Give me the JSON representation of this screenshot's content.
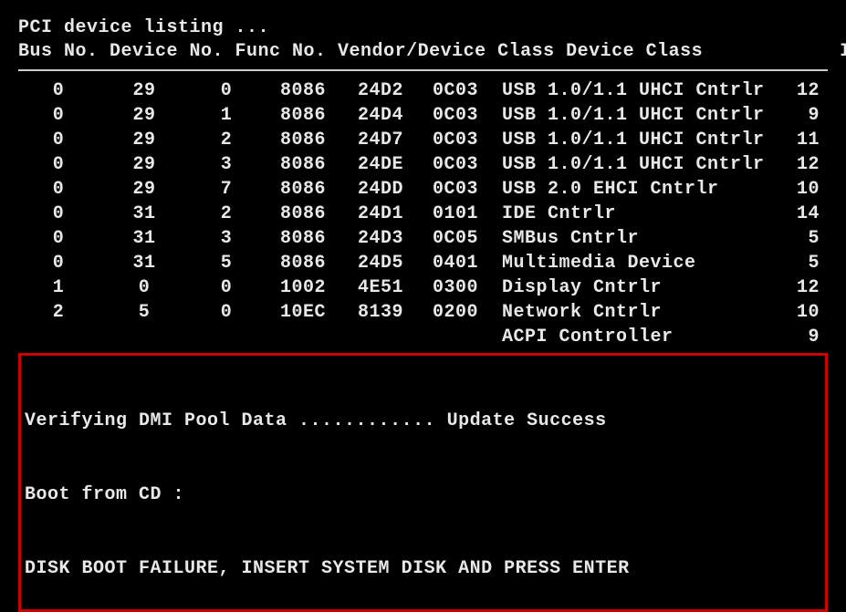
{
  "header": {
    "title": "PCI device listing ...",
    "columns": "Bus No. Device No. Func No. Vendor/Device Class Device Class            IRQ"
  },
  "rows": [
    {
      "bus": "0",
      "dev": "29",
      "func": "0",
      "vendor": "8086",
      "cls1": "24D2",
      "cls2": "0C03",
      "name": "USB 1.0/1.1 UHCI Cntrlr",
      "irq": "12"
    },
    {
      "bus": "0",
      "dev": "29",
      "func": "1",
      "vendor": "8086",
      "cls1": "24D4",
      "cls2": "0C03",
      "name": "USB 1.0/1.1 UHCI Cntrlr",
      "irq": "9"
    },
    {
      "bus": "0",
      "dev": "29",
      "func": "2",
      "vendor": "8086",
      "cls1": "24D7",
      "cls2": "0C03",
      "name": "USB 1.0/1.1 UHCI Cntrlr",
      "irq": "11"
    },
    {
      "bus": "0",
      "dev": "29",
      "func": "3",
      "vendor": "8086",
      "cls1": "24DE",
      "cls2": "0C03",
      "name": "USB 1.0/1.1 UHCI Cntrlr",
      "irq": "12"
    },
    {
      "bus": "0",
      "dev": "29",
      "func": "7",
      "vendor": "8086",
      "cls1": "24DD",
      "cls2": "0C03",
      "name": "USB 2.0 EHCI Cntrlr",
      "irq": "10"
    },
    {
      "bus": "0",
      "dev": "31",
      "func": "2",
      "vendor": "8086",
      "cls1": "24D1",
      "cls2": "0101",
      "name": "IDE Cntrlr",
      "irq": "14"
    },
    {
      "bus": "0",
      "dev": "31",
      "func": "3",
      "vendor": "8086",
      "cls1": "24D3",
      "cls2": "0C05",
      "name": "SMBus Cntrlr",
      "irq": "5"
    },
    {
      "bus": "0",
      "dev": "31",
      "func": "5",
      "vendor": "8086",
      "cls1": "24D5",
      "cls2": "0401",
      "name": "Multimedia Device",
      "irq": "5"
    },
    {
      "bus": "1",
      "dev": "0",
      "func": "0",
      "vendor": "1002",
      "cls1": "4E51",
      "cls2": "0300",
      "name": "Display Cntrlr",
      "irq": "12"
    },
    {
      "bus": "2",
      "dev": "5",
      "func": "0",
      "vendor": "10EC",
      "cls1": "8139",
      "cls2": "0200",
      "name": "Network Cntrlr",
      "irq": "10"
    }
  ],
  "acpi": {
    "name": "ACPI Controller",
    "irq": "9"
  },
  "footer": {
    "line1": "Verifying DMI Pool Data ............ Update Success",
    "line2": "Boot from CD :",
    "line3": "DISK BOOT FAILURE, INSERT SYSTEM DISK AND PRESS ENTER"
  }
}
